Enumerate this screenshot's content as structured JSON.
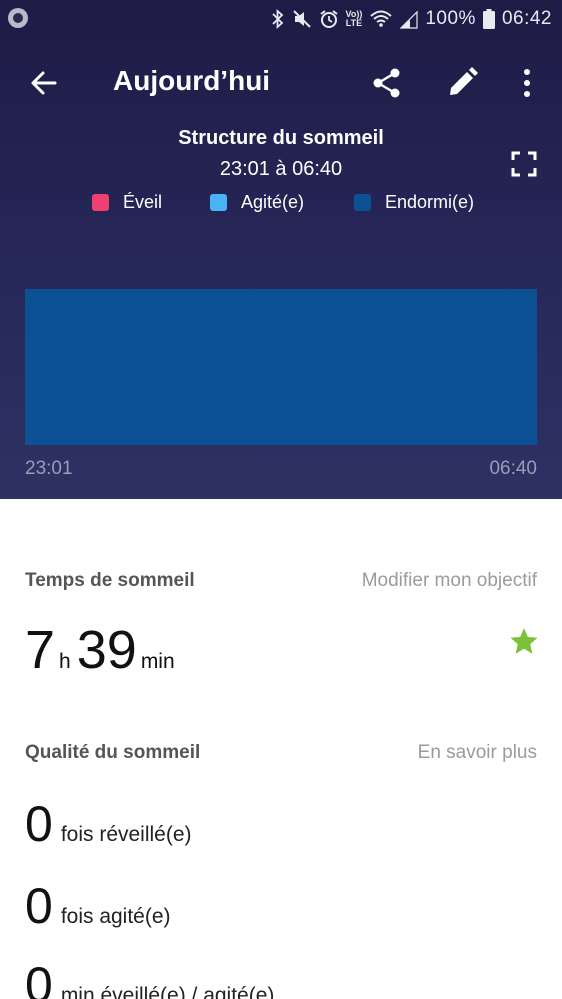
{
  "status_bar": {
    "volte_line1": "Vo))",
    "volte_line2": "LTE",
    "battery": "100%",
    "time": "06:42"
  },
  "app_bar": {
    "title": "Aujourd’hui"
  },
  "chart_data": {
    "type": "area",
    "title": "Structure du sommeil",
    "range": "23:01 à 06:40",
    "legend": [
      {
        "label": "Éveil",
        "color": "#f03f72"
      },
      {
        "label": "Agité(e)",
        "color": "#49b4f5"
      },
      {
        "label": "Endormi(e)",
        "color": "#0c5194"
      }
    ],
    "x_tick_labels": [
      "23:01",
      "06:40"
    ],
    "x_range": [
      "23:01",
      "06:40"
    ],
    "segments": [
      {
        "state": "Endormi(e)",
        "start": "23:01",
        "end": "06:40"
      }
    ],
    "color_area": "#0c5194"
  },
  "sleep_time": {
    "label": "Temps de sommeil",
    "link": "Modifier mon objectif",
    "hours": "7",
    "hours_unit": "h",
    "minutes": "39",
    "minutes_unit": "min"
  },
  "sleep_quality": {
    "label": "Qualité du sommeil",
    "link": "En savoir plus",
    "stats": [
      {
        "value": "0",
        "text": "fois réveillé(e)"
      },
      {
        "value": "0",
        "text": "fois agité(e)"
      },
      {
        "value": "0",
        "text": "min éveillé(e) / agité(e)"
      }
    ]
  },
  "colors": {
    "header_bg": "#252554",
    "goal_star": "#7cc13a"
  },
  "icons": {
    "back": "arrow-left-icon",
    "share": "share-icon",
    "edit": "pencil-icon",
    "more": "more-vert-icon",
    "expand": "fullscreen-icon",
    "star": "star-icon"
  }
}
